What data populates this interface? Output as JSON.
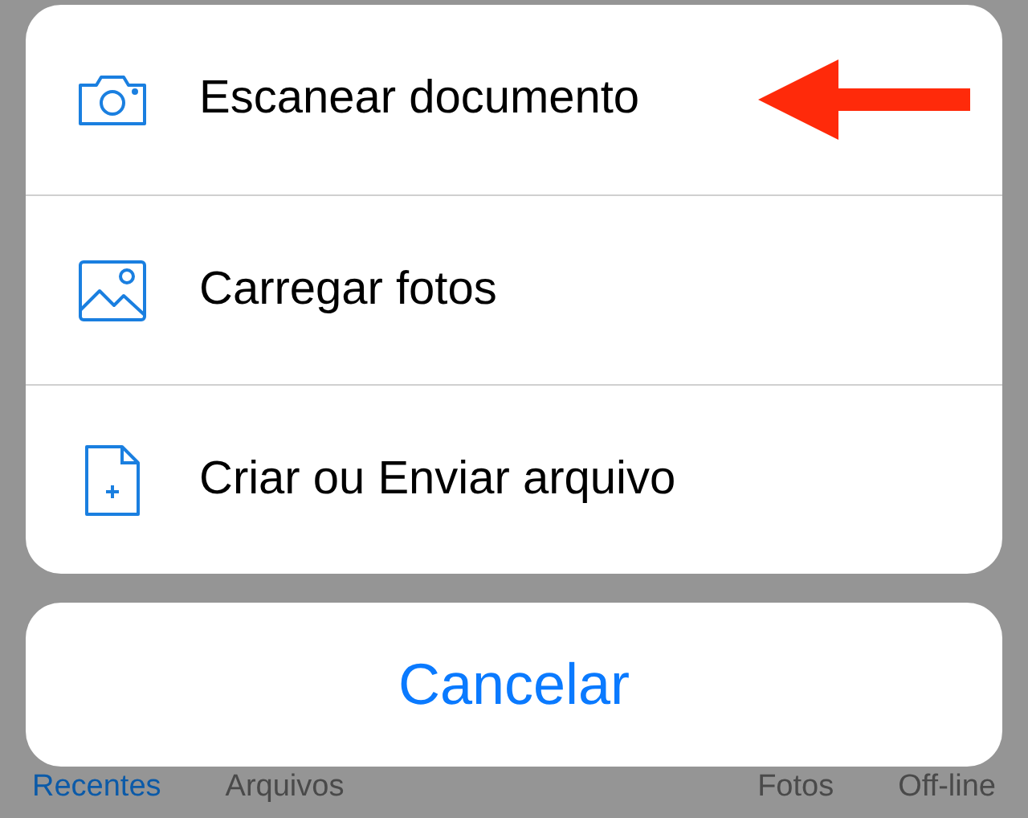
{
  "actions": [
    {
      "kind": "camera",
      "label": "Escanear documento",
      "highlighted": true
    },
    {
      "kind": "image",
      "label": "Carregar fotos",
      "highlighted": false
    },
    {
      "kind": "file",
      "label": "Criar ou Enviar arquivo",
      "highlighted": false
    }
  ],
  "cancel": "Cancelar",
  "tabs": [
    {
      "label": "Recentes",
      "selected": true
    },
    {
      "label": "Arquivos",
      "selected": false
    },
    {
      "label": "Fotos",
      "selected": false
    },
    {
      "label": "Off-line",
      "selected": false
    }
  ]
}
